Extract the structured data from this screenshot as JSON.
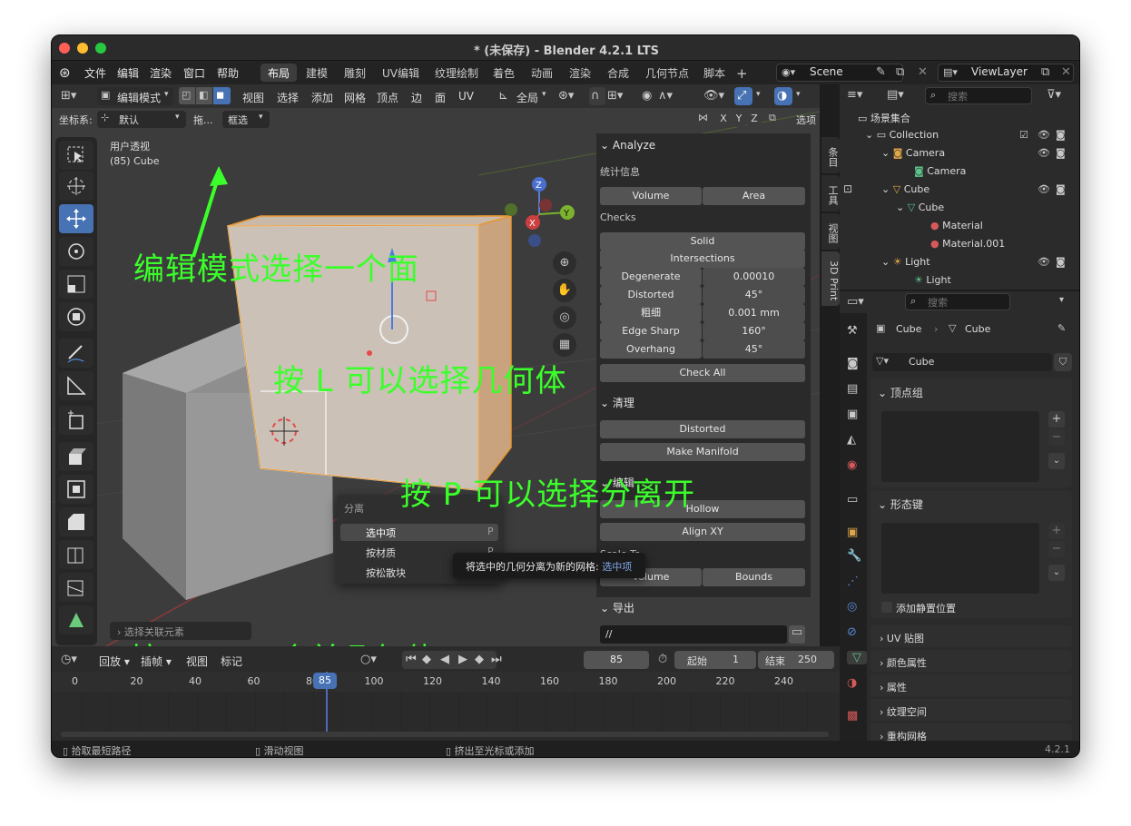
{
  "window": {
    "title": "* (未保存) - Blender 4.2.1 LTS"
  },
  "menu": [
    "文件",
    "编辑",
    "渲染",
    "窗口",
    "帮助"
  ],
  "workspaces": [
    "布局",
    "建模",
    "雕刻",
    "UV编辑",
    "纹理绘制",
    "着色",
    "动画",
    "渲染",
    "合成",
    "几何节点",
    "脚本"
  ],
  "scene": {
    "name": "Scene",
    "view_layer": "ViewLayer"
  },
  "viewport_header": {
    "mode": "编辑模式",
    "menus": [
      "视图",
      "选择",
      "添加",
      "网格",
      "顶点",
      "边",
      "面",
      "UV"
    ],
    "transform": "全局",
    "coord_label": "坐标系:",
    "coord_value": "默认",
    "drag_label": "拖...",
    "select_label": "框选",
    "xyz": [
      "X",
      "Y",
      "Z"
    ],
    "options": "选项"
  },
  "viewport": {
    "view_name": "用户透视",
    "object_info": "(85) Cube",
    "last_op": "选择关联元素"
  },
  "npanel": {
    "analyze_title": "Analyze",
    "stats_label": "统计信息",
    "stats_buttons": [
      "Volume",
      "Area"
    ],
    "checks_label": "Checks",
    "checks": [
      "Solid",
      "Intersections"
    ],
    "check_rows": [
      {
        "name": "Degenerate",
        "value": "0.00010"
      },
      {
        "name": "Distorted",
        "value": "45°"
      },
      {
        "name": "粗细",
        "value": "0.001 mm"
      },
      {
        "name": "Edge Sharp",
        "value": "160°"
      },
      {
        "name": "Overhang",
        "value": "45°"
      }
    ],
    "check_all": "Check All",
    "cleanup_title": "清理",
    "cleanup_buttons": [
      "Distorted",
      "Make Manifold"
    ],
    "edit_title": "编辑",
    "edit_buttons": [
      "Hollow",
      "Align XY"
    ],
    "scale_label": "Scale To",
    "scale_buttons": [
      "Volume",
      "Bounds"
    ],
    "export_title": "导出",
    "export_path": "//",
    "tabs": [
      "条目",
      "工具",
      "视图",
      "3D Print"
    ]
  },
  "separate_menu": {
    "title": "分离",
    "items": [
      {
        "label": "选中项",
        "key": "P"
      },
      {
        "label": "按材质",
        "key": "P"
      },
      {
        "label": "按松散块",
        "key": ""
      }
    ],
    "tooltip_text": "将选中的几何分离为新的网格:",
    "tooltip_value": "选中项"
  },
  "annotations": [
    "编辑模式选择一个面",
    "按 L 可以选择几何体",
    "按 P 可以选择分离开",
    "按  CMD J 合并几何体"
  ],
  "outliner": {
    "search_placeholder": "搜索",
    "items": [
      {
        "label": "场景集合",
        "indent": 0
      },
      {
        "label": "Collection",
        "indent": 1
      },
      {
        "label": "Camera",
        "indent": 2
      },
      {
        "label": "Camera",
        "indent": 3
      },
      {
        "label": "Cube",
        "indent": 2
      },
      {
        "label": "Cube",
        "indent": 3
      },
      {
        "label": "Material",
        "indent": 4
      },
      {
        "label": "Material.001",
        "indent": 4
      },
      {
        "label": "Light",
        "indent": 2
      },
      {
        "label": "Light",
        "indent": 3
      }
    ]
  },
  "properties": {
    "search_placeholder": "搜索",
    "breadcrumb": [
      "Cube",
      "Cube"
    ],
    "mesh_name": "Cube",
    "vgroups_title": "顶点组",
    "shapekeys_title": "形态键",
    "rest_pos_label": "添加静置位置",
    "sections": [
      "UV 贴图",
      "颜色属性",
      "属性",
      "纹理空间",
      "重构网格"
    ]
  },
  "timeline": {
    "menus": [
      "回放",
      "插帧",
      "视图",
      "标记"
    ],
    "current_frame": "85",
    "start_label": "起始",
    "start_value": "1",
    "end_label": "结束",
    "end_value": "250",
    "ticks": [
      "0",
      "20",
      "40",
      "60",
      "80",
      "100",
      "120",
      "140",
      "160",
      "180",
      "200",
      "220",
      "240"
    ]
  },
  "statusbar": {
    "items": [
      "拾取最短路径",
      "滑动视图",
      "挤出至光标或添加"
    ],
    "version": "4.2.1"
  }
}
